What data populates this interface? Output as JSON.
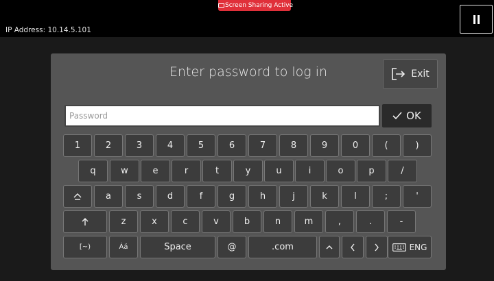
{
  "topbar": {
    "share_badge": "Screen Sharing Active",
    "ip_address": "IP Address: 10.14.5.101",
    "pause_icon": "pause-icon"
  },
  "login": {
    "title": "Enter password to log in",
    "exit_label": "Exit",
    "password_placeholder": "Password",
    "ok_label": "OK"
  },
  "keyboard": {
    "row1": [
      "1",
      "2",
      "3",
      "4",
      "5",
      "6",
      "7",
      "8",
      "9",
      "0",
      "(",
      ")"
    ],
    "row2": [
      "q",
      "w",
      "e",
      "r",
      "t",
      "y",
      "u",
      "i",
      "o",
      "p",
      "/"
    ],
    "row3": [
      "a",
      "s",
      "d",
      "f",
      "g",
      "h",
      "j",
      "k",
      "l",
      ";",
      "'"
    ],
    "row4": [
      "z",
      "x",
      "c",
      "v",
      "b",
      "n",
      "m",
      ",",
      ".",
      "-"
    ],
    "symbols_label": "[~)",
    "accents_label": "Áá",
    "space_label": "Space",
    "at_label": "@",
    "dotcom_label": ".com",
    "language_label": "ENG"
  },
  "colors": {
    "badge": "#e0303a",
    "panel": "#555555",
    "key": "#3c3c3c"
  }
}
